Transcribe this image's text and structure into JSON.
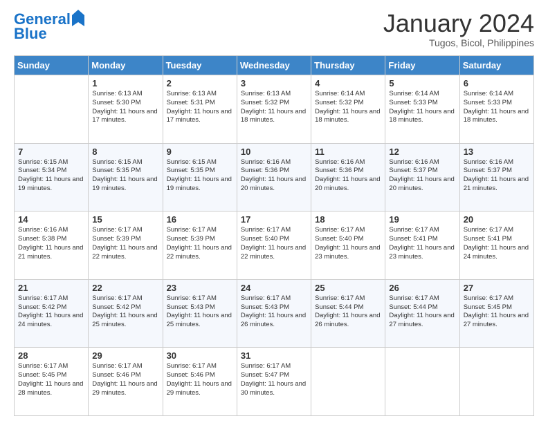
{
  "header": {
    "logo_line1": "General",
    "logo_line2": "Blue",
    "month": "January 2024",
    "location": "Tugos, Bicol, Philippines"
  },
  "days_of_week": [
    "Sunday",
    "Monday",
    "Tuesday",
    "Wednesday",
    "Thursday",
    "Friday",
    "Saturday"
  ],
  "weeks": [
    [
      {
        "day": "",
        "sunrise": "",
        "sunset": "",
        "daylight": ""
      },
      {
        "day": "1",
        "sunrise": "Sunrise: 6:13 AM",
        "sunset": "Sunset: 5:30 PM",
        "daylight": "Daylight: 11 hours and 17 minutes."
      },
      {
        "day": "2",
        "sunrise": "Sunrise: 6:13 AM",
        "sunset": "Sunset: 5:31 PM",
        "daylight": "Daylight: 11 hours and 17 minutes."
      },
      {
        "day": "3",
        "sunrise": "Sunrise: 6:13 AM",
        "sunset": "Sunset: 5:32 PM",
        "daylight": "Daylight: 11 hours and 18 minutes."
      },
      {
        "day": "4",
        "sunrise": "Sunrise: 6:14 AM",
        "sunset": "Sunset: 5:32 PM",
        "daylight": "Daylight: 11 hours and 18 minutes."
      },
      {
        "day": "5",
        "sunrise": "Sunrise: 6:14 AM",
        "sunset": "Sunset: 5:33 PM",
        "daylight": "Daylight: 11 hours and 18 minutes."
      },
      {
        "day": "6",
        "sunrise": "Sunrise: 6:14 AM",
        "sunset": "Sunset: 5:33 PM",
        "daylight": "Daylight: 11 hours and 18 minutes."
      }
    ],
    [
      {
        "day": "7",
        "sunrise": "Sunrise: 6:15 AM",
        "sunset": "Sunset: 5:34 PM",
        "daylight": "Daylight: 11 hours and 19 minutes."
      },
      {
        "day": "8",
        "sunrise": "Sunrise: 6:15 AM",
        "sunset": "Sunset: 5:35 PM",
        "daylight": "Daylight: 11 hours and 19 minutes."
      },
      {
        "day": "9",
        "sunrise": "Sunrise: 6:15 AM",
        "sunset": "Sunset: 5:35 PM",
        "daylight": "Daylight: 11 hours and 19 minutes."
      },
      {
        "day": "10",
        "sunrise": "Sunrise: 6:16 AM",
        "sunset": "Sunset: 5:36 PM",
        "daylight": "Daylight: 11 hours and 20 minutes."
      },
      {
        "day": "11",
        "sunrise": "Sunrise: 6:16 AM",
        "sunset": "Sunset: 5:36 PM",
        "daylight": "Daylight: 11 hours and 20 minutes."
      },
      {
        "day": "12",
        "sunrise": "Sunrise: 6:16 AM",
        "sunset": "Sunset: 5:37 PM",
        "daylight": "Daylight: 11 hours and 20 minutes."
      },
      {
        "day": "13",
        "sunrise": "Sunrise: 6:16 AM",
        "sunset": "Sunset: 5:37 PM",
        "daylight": "Daylight: 11 hours and 21 minutes."
      }
    ],
    [
      {
        "day": "14",
        "sunrise": "Sunrise: 6:16 AM",
        "sunset": "Sunset: 5:38 PM",
        "daylight": "Daylight: 11 hours and 21 minutes."
      },
      {
        "day": "15",
        "sunrise": "Sunrise: 6:17 AM",
        "sunset": "Sunset: 5:39 PM",
        "daylight": "Daylight: 11 hours and 22 minutes."
      },
      {
        "day": "16",
        "sunrise": "Sunrise: 6:17 AM",
        "sunset": "Sunset: 5:39 PM",
        "daylight": "Daylight: 11 hours and 22 minutes."
      },
      {
        "day": "17",
        "sunrise": "Sunrise: 6:17 AM",
        "sunset": "Sunset: 5:40 PM",
        "daylight": "Daylight: 11 hours and 22 minutes."
      },
      {
        "day": "18",
        "sunrise": "Sunrise: 6:17 AM",
        "sunset": "Sunset: 5:40 PM",
        "daylight": "Daylight: 11 hours and 23 minutes."
      },
      {
        "day": "19",
        "sunrise": "Sunrise: 6:17 AM",
        "sunset": "Sunset: 5:41 PM",
        "daylight": "Daylight: 11 hours and 23 minutes."
      },
      {
        "day": "20",
        "sunrise": "Sunrise: 6:17 AM",
        "sunset": "Sunset: 5:41 PM",
        "daylight": "Daylight: 11 hours and 24 minutes."
      }
    ],
    [
      {
        "day": "21",
        "sunrise": "Sunrise: 6:17 AM",
        "sunset": "Sunset: 5:42 PM",
        "daylight": "Daylight: 11 hours and 24 minutes."
      },
      {
        "day": "22",
        "sunrise": "Sunrise: 6:17 AM",
        "sunset": "Sunset: 5:42 PM",
        "daylight": "Daylight: 11 hours and 25 minutes."
      },
      {
        "day": "23",
        "sunrise": "Sunrise: 6:17 AM",
        "sunset": "Sunset: 5:43 PM",
        "daylight": "Daylight: 11 hours and 25 minutes."
      },
      {
        "day": "24",
        "sunrise": "Sunrise: 6:17 AM",
        "sunset": "Sunset: 5:43 PM",
        "daylight": "Daylight: 11 hours and 26 minutes."
      },
      {
        "day": "25",
        "sunrise": "Sunrise: 6:17 AM",
        "sunset": "Sunset: 5:44 PM",
        "daylight": "Daylight: 11 hours and 26 minutes."
      },
      {
        "day": "26",
        "sunrise": "Sunrise: 6:17 AM",
        "sunset": "Sunset: 5:44 PM",
        "daylight": "Daylight: 11 hours and 27 minutes."
      },
      {
        "day": "27",
        "sunrise": "Sunrise: 6:17 AM",
        "sunset": "Sunset: 5:45 PM",
        "daylight": "Daylight: 11 hours and 27 minutes."
      }
    ],
    [
      {
        "day": "28",
        "sunrise": "Sunrise: 6:17 AM",
        "sunset": "Sunset: 5:45 PM",
        "daylight": "Daylight: 11 hours and 28 minutes."
      },
      {
        "day": "29",
        "sunrise": "Sunrise: 6:17 AM",
        "sunset": "Sunset: 5:46 PM",
        "daylight": "Daylight: 11 hours and 29 minutes."
      },
      {
        "day": "30",
        "sunrise": "Sunrise: 6:17 AM",
        "sunset": "Sunset: 5:46 PM",
        "daylight": "Daylight: 11 hours and 29 minutes."
      },
      {
        "day": "31",
        "sunrise": "Sunrise: 6:17 AM",
        "sunset": "Sunset: 5:47 PM",
        "daylight": "Daylight: 11 hours and 30 minutes."
      },
      {
        "day": "",
        "sunrise": "",
        "sunset": "",
        "daylight": ""
      },
      {
        "day": "",
        "sunrise": "",
        "sunset": "",
        "daylight": ""
      },
      {
        "day": "",
        "sunrise": "",
        "sunset": "",
        "daylight": ""
      }
    ]
  ]
}
